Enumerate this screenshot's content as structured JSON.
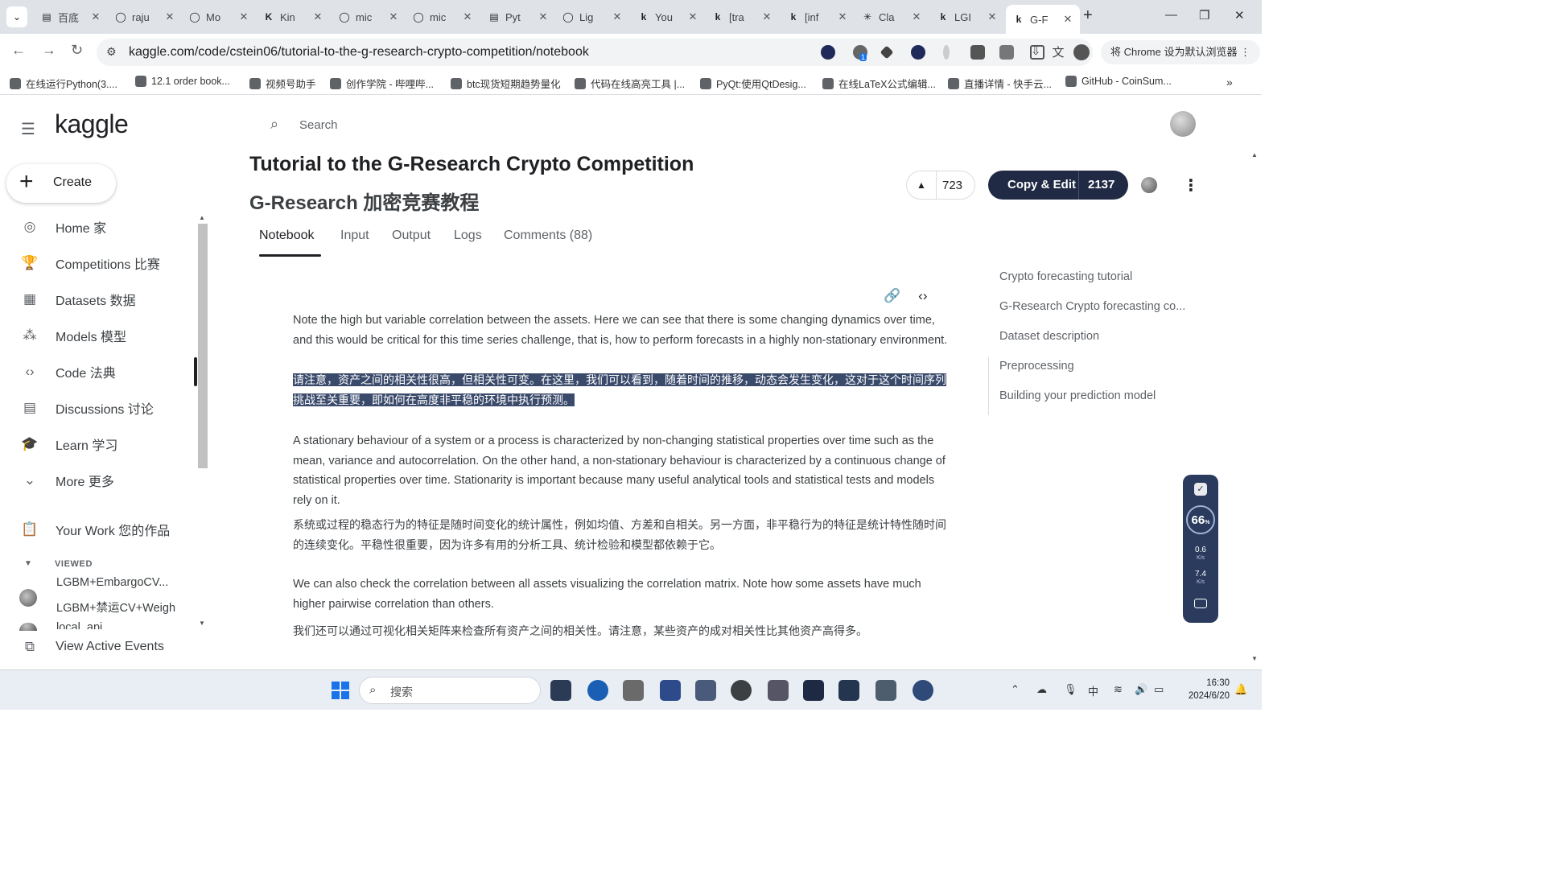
{
  "browser": {
    "tabs": [
      {
        "label": "百底",
        "icon": "doc-icon"
      },
      {
        "label": "raju",
        "icon": "github-icon"
      },
      {
        "label": "Mo",
        "icon": "github-icon"
      },
      {
        "label": "Kin",
        "icon": "k-icon"
      },
      {
        "label": "mic",
        "icon": "github-icon"
      },
      {
        "label": "mic",
        "icon": "github-icon"
      },
      {
        "label": "Pyt",
        "icon": "doc-icon"
      },
      {
        "label": "Lig",
        "icon": "github-icon"
      },
      {
        "label": "You",
        "icon": "kaggle-icon"
      },
      {
        "label": "[tra",
        "icon": "kaggle-icon"
      },
      {
        "label": "[inf",
        "icon": "kaggle-icon"
      },
      {
        "label": "Cla",
        "icon": "spark-icon"
      },
      {
        "label": "LGI",
        "icon": "kaggle-icon"
      },
      {
        "label": "G-F",
        "icon": "kaggle-icon",
        "active": true
      }
    ],
    "url": "kaggle.com/code/cstein06/tutorial-to-the-g-research-crypto-competition/notebook",
    "default_browser_label": "将 Chrome 设为默认浏览器",
    "bookmarks": [
      "在线运行Python(3....",
      "12.1 order book...",
      "视频号助手",
      "创作学院 - 哔哩哔...",
      "btc现货短期趋势量化",
      "代码在线高亮工具 |...",
      "PyQt:使用QtDesig...",
      "在线LaTeX公式编辑...",
      "直播详情 - 快手云...",
      "GitHub - CoinSum..."
    ],
    "extension_badge": "1"
  },
  "kaggle": {
    "logo": "kaggle",
    "search_placeholder": "Search",
    "create_label": "Create",
    "nav": [
      {
        "label": "Home 家",
        "icon": "compass-icon"
      },
      {
        "label": "Competitions 比赛",
        "icon": "trophy-icon"
      },
      {
        "label": "Datasets 数据",
        "icon": "table-icon"
      },
      {
        "label": "Models 模型",
        "icon": "models-icon"
      },
      {
        "label": "Code 法典",
        "icon": "code-icon",
        "active": true
      },
      {
        "label": "Discussions 讨论",
        "icon": "discussion-icon"
      },
      {
        "label": "Learn 学习",
        "icon": "graduation-cap-icon"
      },
      {
        "label": "More 更多",
        "icon": "chevron-down-icon"
      }
    ],
    "your_work": "Your Work 您的作品",
    "viewed_label": "VIEWED",
    "viewed_items": [
      "LGBM+EmbargoCV...",
      "LGBM+禁运CV+Weigh",
      "local_api"
    ],
    "view_active_events": "View Active Events"
  },
  "notebook": {
    "title_en": "Tutorial to the G-Research Crypto Competition",
    "title_cn": "G-Research 加密竞赛教程",
    "upvotes": "723",
    "copy_edit_label": "Copy & Edit",
    "copy_edit_count": "2137",
    "tabs": [
      "Notebook",
      "Input",
      "Output",
      "Logs",
      "Comments (88)"
    ],
    "paragraphs": {
      "p1": "Note the high but variable correlation between the assets. Here we can see that there is some changing dynamics over time, and this would be critical for this time series challenge, that is, how to perform forecasts in a highly non-stationary environment.",
      "p1_cn": "请注意，资产之间的相关性很高，但相关性可变。在这里，我们可以看到，随着时间的推移，动态会发生变化，这对于这个时间序列挑战至关重要，即如何在高度非平稳的环境中执行预测。",
      "p2": "A stationary behaviour of a system or a process is characterized by non-changing statistical properties over time such as the mean, variance and autocorrelation. On the other hand, a non-stationary behaviour is characterized by a continuous change of statistical properties over time. Stationarity is important because many useful analytical tools and statistical tests and models rely on it.",
      "p2_cn": "系统或过程的稳态行为的特征是随时间变化的统计属性，例如均值、方差和自相关。另一方面，非平稳行为的特征是统计特性随时间的连续变化。平稳性很重要，因为许多有用的分析工具、统计检验和模型都依赖于它。",
      "p3": "We can also check the correlation between all assets visualizing the correlation matrix. Note how some assets have much higher pairwise correlation than others.",
      "p3_cn": "我们还可以通过可视化相关矩阵来检查所有资产之间的相关性。请注意，某些资产的成对相关性比其他资产高得多。"
    },
    "toc": [
      "Crypto forecasting tutorial",
      "G-Research Crypto forecasting co...",
      "Dataset description",
      "Preprocessing",
      "Building your prediction model"
    ]
  },
  "net_widget": {
    "percent": "66",
    "percent_unit": "%",
    "upload": "0.6",
    "download": "7.4",
    "unit": "K/s"
  },
  "taskbar": {
    "search_placeholder": "搜索",
    "ime": "中",
    "time": "16:30",
    "date": "2024/6/20"
  }
}
